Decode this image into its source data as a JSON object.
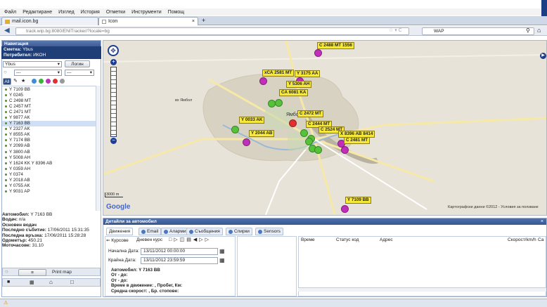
{
  "menu": [
    "Файл",
    "Редактиране",
    "Изглед",
    "История",
    "Отметки",
    "Инструменти",
    "Помощ"
  ],
  "tabs": [
    {
      "label": "mail.icon.bg"
    },
    {
      "label": "Icon"
    }
  ],
  "tab_close": "×",
  "tab_add": "+",
  "url": "track.wip.bg:8080/ENITracker/?locale=bg",
  "search_engine": "WAP",
  "left_header": "Навигация",
  "account_label": "Сметка:",
  "account_value": "Ybus",
  "user_label": "Потребител:",
  "user_value": "ИКОН",
  "select_account": "Ybus",
  "logout_label": "Логин",
  "select_group": "---",
  "select_filter": "---",
  "all_label": "All",
  "vehicles": [
    "Y 7109 BB",
    "Y 0245",
    "C 2498 MT",
    "C 2457 MT",
    "C 2471 MT",
    "Y 9877 AK",
    "Y 7163 BB",
    "Y 2327 AK",
    "Y 8555 AK",
    "Y 7174 BB",
    "Y 2099 AB",
    "Y 3800 AB",
    "Y 5008 AH",
    "Y 1624 KK Y 8396 AB",
    "Y 0359 AH",
    "Y 0374",
    "Y 2018 AB",
    "Y 0755 AK",
    "Y 9031 AP"
  ],
  "selected_vehicle_index": 6,
  "details": [
    {
      "label": "Автомобил:",
      "value": "Y 7163 BB"
    },
    {
      "label": "Водач:",
      "value": "n/a"
    },
    {
      "label": "Основен водач",
      "value": ""
    },
    {
      "label": "Последно събитие:",
      "value": "17/06/2011 15:31:35"
    },
    {
      "label": "Последна връзка:",
      "value": "17/06/2011 15:28:28"
    },
    {
      "label": "Одометър:",
      "value": "450.21"
    },
    {
      "label": "Моточасове:",
      "value": "31.10"
    }
  ],
  "print_map": "Print map",
  "map": {
    "google": "Google",
    "scale": "3000 m",
    "copyright": "Картографски данни ©2012 - Условия за ползване",
    "city": "Ямбол",
    "place": "вх Ямбол",
    "markers": [
      {
        "label": "C 2488 MT",
        "suffix": "1556",
        "color": "#c02fb8"
      },
      {
        "label": "хСА 2581 МТ",
        "color": "#c02fb8"
      },
      {
        "label": "Y 3175 AA",
        "color": "#c02fb8"
      },
      {
        "label": "Y 5306 AH",
        "color": "#55c23a"
      },
      {
        "label": "CA 6081 KA",
        "color": "#55c23a"
      },
      {
        "label": "C 2472 MT",
        "color": "#e03030"
      },
      {
        "label": "Y 0033 AK",
        "color": "#55c23a"
      },
      {
        "label": "Y 2044 AB",
        "color": "#c02fb8"
      },
      {
        "label": "C 2444 MT",
        "color": "#55c23a"
      },
      {
        "label": "C 2524 MT",
        "color": "#55c23a"
      },
      {
        "label": "X 8396 AB",
        "suffix": "8414",
        "color": "#c02fb8"
      },
      {
        "label": "C 2481 MT",
        "color": "#c02fb8"
      },
      {
        "label": "Y 7109 BB",
        "color": "#c02fb8"
      }
    ]
  },
  "bottom": {
    "header": "Детайли за автомобил",
    "tabs": [
      "Движения",
      "Email",
      "Аларми",
      "Съобщения",
      "Спирки",
      "Sensors"
    ],
    "courses_label": "Курсове",
    "daily_label": "Дневен курс",
    "start_label": "Начална Дата:",
    "start_value": "13/11/2012 00:00:00",
    "end_label": "Крайна Дата:",
    "end_value": "13/11/2012 23:59:59",
    "summary": [
      "Автомобил: Y 7163 BB",
      "От - до:",
      "От - до:",
      "Време в движение: , Пробег, Км:",
      "Средна скорост: , Бр. стопове:"
    ],
    "columns": [
      "Време",
      "Статус код",
      "Адрес",
      "Скорост/km/h",
      "Ca"
    ]
  }
}
